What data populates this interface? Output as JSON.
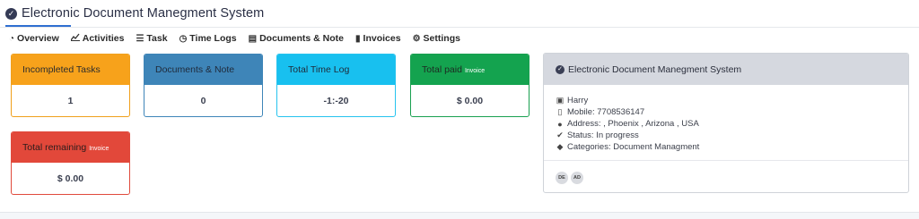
{
  "page": {
    "title": "Electronic Document Manegment System"
  },
  "tabs": [
    {
      "label": "Overview",
      "icon": "dashboard-icon"
    },
    {
      "label": "Activities",
      "icon": "chart-icon"
    },
    {
      "label": "Task",
      "icon": "list-icon"
    },
    {
      "label": "Time Logs",
      "icon": "clock-icon"
    },
    {
      "label": "Documents & Note",
      "icon": "document-icon"
    },
    {
      "label": "Invoices",
      "icon": "file-icon"
    },
    {
      "label": "Settings",
      "icon": "gears-icon"
    }
  ],
  "cards": {
    "incompleted": {
      "label": "Incompleted Tasks",
      "value": "1"
    },
    "documents": {
      "label": "Documents & Note",
      "value": "0"
    },
    "timelog": {
      "label": "Total Time Log",
      "value": "-1:-20"
    },
    "paid": {
      "label": "Total paid",
      "sup": "Invoice",
      "value": "$ 0.00"
    },
    "remaining": {
      "label": "Total remaining",
      "sup": "Invoice",
      "value": "$ 0.00"
    }
  },
  "info": {
    "title": "Electronic Document Manegment System",
    "client": "Harry",
    "mobile": "Mobile: 7708536147",
    "address": "Address: , Phoenix , Arizona , USA",
    "status": "Status: In progress",
    "categories": "Categories: Document Managment",
    "members": [
      "DE",
      "AD"
    ]
  },
  "colors": {
    "accent": "#2f6fd1",
    "orange": "#f7a21b",
    "blue": "#3e85b8",
    "cyan": "#18c0ef",
    "green": "#14a34f",
    "red": "#e2483a"
  }
}
